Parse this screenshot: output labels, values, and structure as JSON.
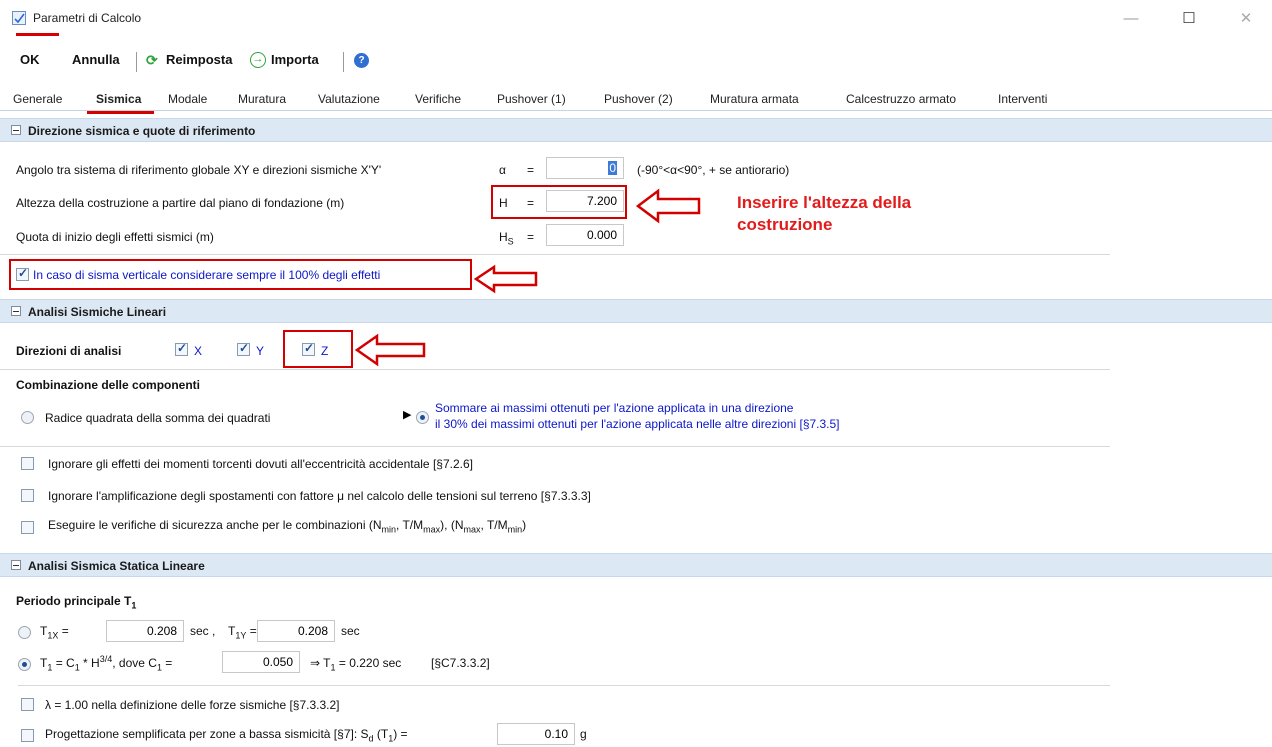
{
  "window": {
    "title": "Parametri di Calcolo",
    "minimize": "—",
    "maximize": "☐",
    "close": "✕"
  },
  "toolbar": {
    "ok": "OK",
    "cancel": "Annulla",
    "reset": "Reimposta",
    "import": "Importa"
  },
  "tabs": [
    "Generale",
    "Sismica",
    "Modale",
    "Muratura",
    "Valutazione",
    "Verifiche",
    "Pushover (1)",
    "Pushover (2)",
    "Muratura armata",
    "Calcestruzzo armato",
    "Interventi"
  ],
  "section1": {
    "title": "Direzione sismica e quote di riferimento",
    "angle_label": "Angolo tra sistema di riferimento globale XY e direzioni sismiche X'Y'",
    "alpha_symbol": "α",
    "eq": "=",
    "angle_value": "0",
    "angle_hint": "(-90°<α<90°, + se antiorario)",
    "height_label": "Altezza della costruzione a partire dal piano di fondazione (m)",
    "height_symbol": "H",
    "height_value": "7.200",
    "quota_label": "Quota di inizio degli effetti sismici (m)",
    "quota_symbol": "H",
    "quota_sub": "S",
    "quota_value": "0.000",
    "annotation": "Inserire l'altezza della costruzione",
    "vertical_check": "In caso di sisma verticale considerare sempre il 100% degli effetti"
  },
  "section2": {
    "title": "Analisi Sismiche Lineari",
    "directions_label": "Direzioni di analisi",
    "dir_x": "X",
    "dir_y": "Y",
    "dir_z": "Z",
    "combination_label": "Combinazione delle componenti",
    "radio_srss": "Radice quadrata della somma dei quadrati",
    "radio_sum_line1": "Sommare ai massimi ottenuti per l'azione applicata in una direzione",
    "radio_sum_line2": "il 30% dei massimi ottenuti per l'azione applicata nelle altre direzioni [§7.3.5]",
    "opt1": "Ignorare gli effetti dei momenti torcenti dovuti all'eccentricità accidentale [§7.2.6]",
    "opt2": "Ignorare l'amplificazione degli spostamenti con fattore μ nel calcolo delle tensioni sul terreno [§7.3.3.3]",
    "opt3_prefix": "Eseguire le verifiche di sicurezza anche per le combinazioni (N",
    "opt3_min": "min",
    "opt3_mid1": ", T/M",
    "opt3_max": "max",
    "opt3_mid2": "), (N",
    "opt3_max2": "max",
    "opt3_mid3": ", T/M",
    "opt3_min2": "min",
    "opt3_end": ")"
  },
  "section3": {
    "title": "Analisi Sismica Statica Lineare",
    "period_label": "Periodo principale T",
    "period_sub": "1",
    "t1x_label": "T",
    "t1x_sub": "1X",
    "t1x_eq": "=",
    "t1x_value": "0.208",
    "t1x_unit": "sec ,",
    "t1y_label": "T",
    "t1y_sub": "1Y",
    "t1y_eq": "=",
    "t1y_value": "0.208",
    "t1y_unit": "sec",
    "formula_prefix": "T",
    "formula_sub": "1",
    "formula_mid": " = C",
    "formula_sub2": "1",
    "formula_rest": " * H",
    "formula_sup": "3/4",
    "formula_dove": ", dove C",
    "formula_sub3": "1",
    "formula_eq": " =",
    "c1_value": "0.050",
    "formula_result": "⇒ T",
    "formula_result_sub": "1",
    "formula_result_rest": " = 0.220 sec",
    "formula_ref": "[§C7.3.3.2]",
    "lambda_check": "λ = 1.00 nella definizione delle forze sismiche [§7.3.3.2]",
    "simplified_prefix": "Progettazione semplificata per zone a bassa sismicità [§7]:  S",
    "simplified_sub": "d",
    "simplified_rest": " (T",
    "simplified_sub2": "1",
    "simplified_eq": ") =",
    "sd_value": "0.10",
    "sd_unit": "g"
  },
  "colors": {
    "accent_red": "#d60000",
    "header_blue": "#dce8f4",
    "link_blue": "#0c17c9"
  }
}
